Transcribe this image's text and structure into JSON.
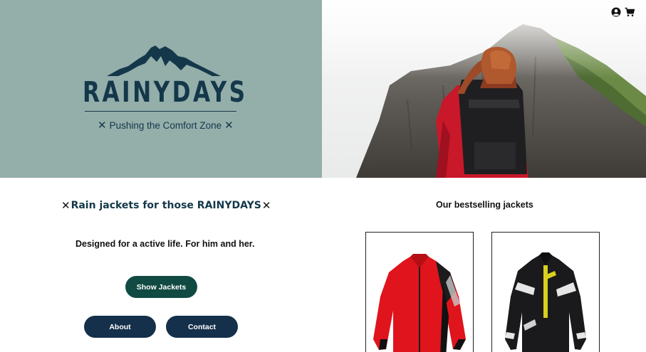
{
  "hero": {
    "brand": "RAINYDAYS",
    "tagline": "Pushing the Comfort Zone",
    "tagline_mark": "✕"
  },
  "header": {
    "icons": [
      "user-account-icon",
      "shopping-cart-icon"
    ]
  },
  "promo": {
    "title": "Rain jackets for those RAINYDAYS",
    "title_mark": "✕",
    "subtitle": "Designed for a active life. For him and her.",
    "show_button": "Show Jackets",
    "about_button": "About",
    "contact_button": "Contact"
  },
  "bestselling": {
    "title": "Our bestselling jackets"
  },
  "colors": {
    "hero_left_bg": "#94aeaa",
    "brand_navy": "#14384a",
    "show_button_bg": "#104a42",
    "nav_button_bg": "#14304a"
  }
}
